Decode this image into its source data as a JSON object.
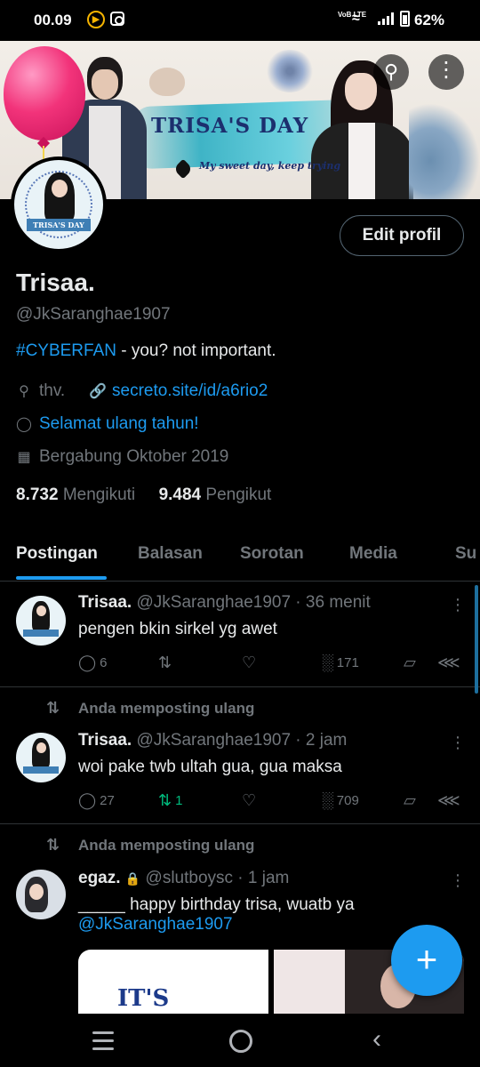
{
  "status_bar": {
    "time": "00.09",
    "volte": "VoB LTE",
    "battery": "62%"
  },
  "banner": {
    "title": "TRISA'S DAY",
    "tagline": "My sweet day, keep trying"
  },
  "avatar": {
    "label": "TRISA'S DAY"
  },
  "profile": {
    "edit_button": "Edit profil",
    "name": "Trisaa.",
    "handle": "@JkSaranghae1907",
    "bio_tag": "#CYBERFAN",
    "bio_rest": " - you? not important.",
    "location": "thv.",
    "link": "secreto.site/id/a6rio2",
    "birthday": "Selamat ulang tahun!",
    "joined": "Bergabung Oktober 2019",
    "following_count": "8.732",
    "following_label": "Mengikuti",
    "followers_count": "9.484",
    "followers_label": "Pengikut"
  },
  "tabs": [
    {
      "label": "Postingan"
    },
    {
      "label": "Balasan"
    },
    {
      "label": "Sorotan"
    },
    {
      "label": "Media"
    },
    {
      "label": "Su"
    }
  ],
  "posts": [
    {
      "name": "Trisaa.",
      "meta": "@JkSaranghae1907 · 36 menit",
      "text": "pengen bkin sirkel yg awet",
      "replies": "6",
      "reposts": "",
      "likes": "",
      "views": "171"
    },
    {
      "repost_label": "Anda memposting ulang",
      "name": "Trisaa.",
      "meta": "@JkSaranghae1907 · 2 jam",
      "text": "woi pake twb ultah gua, gua maksa",
      "replies": "27",
      "reposts": "1",
      "likes": "",
      "views": "709"
    },
    {
      "repost_label": "Anda memposting ulang",
      "name": "egaz.",
      "meta": "@slutboysc · 1 jam",
      "text": "_____ happy birthday trisa, wuatb ya",
      "mention": "@JkSaranghae1907",
      "media_text": "IT'S"
    }
  ],
  "colors": {
    "accent": "#1d9bf0",
    "repost_active": "#00ba7c",
    "muted": "#71767b",
    "text": "#e7e9ea",
    "background": "#000000"
  },
  "icons": [
    "search-icon",
    "more-vertical-icon",
    "location-icon",
    "link-icon",
    "balloon-icon",
    "calendar-icon",
    "reply-icon",
    "repost-icon",
    "like-icon",
    "views-icon",
    "bookmark-icon",
    "share-icon",
    "lock-icon",
    "plus-icon"
  ]
}
